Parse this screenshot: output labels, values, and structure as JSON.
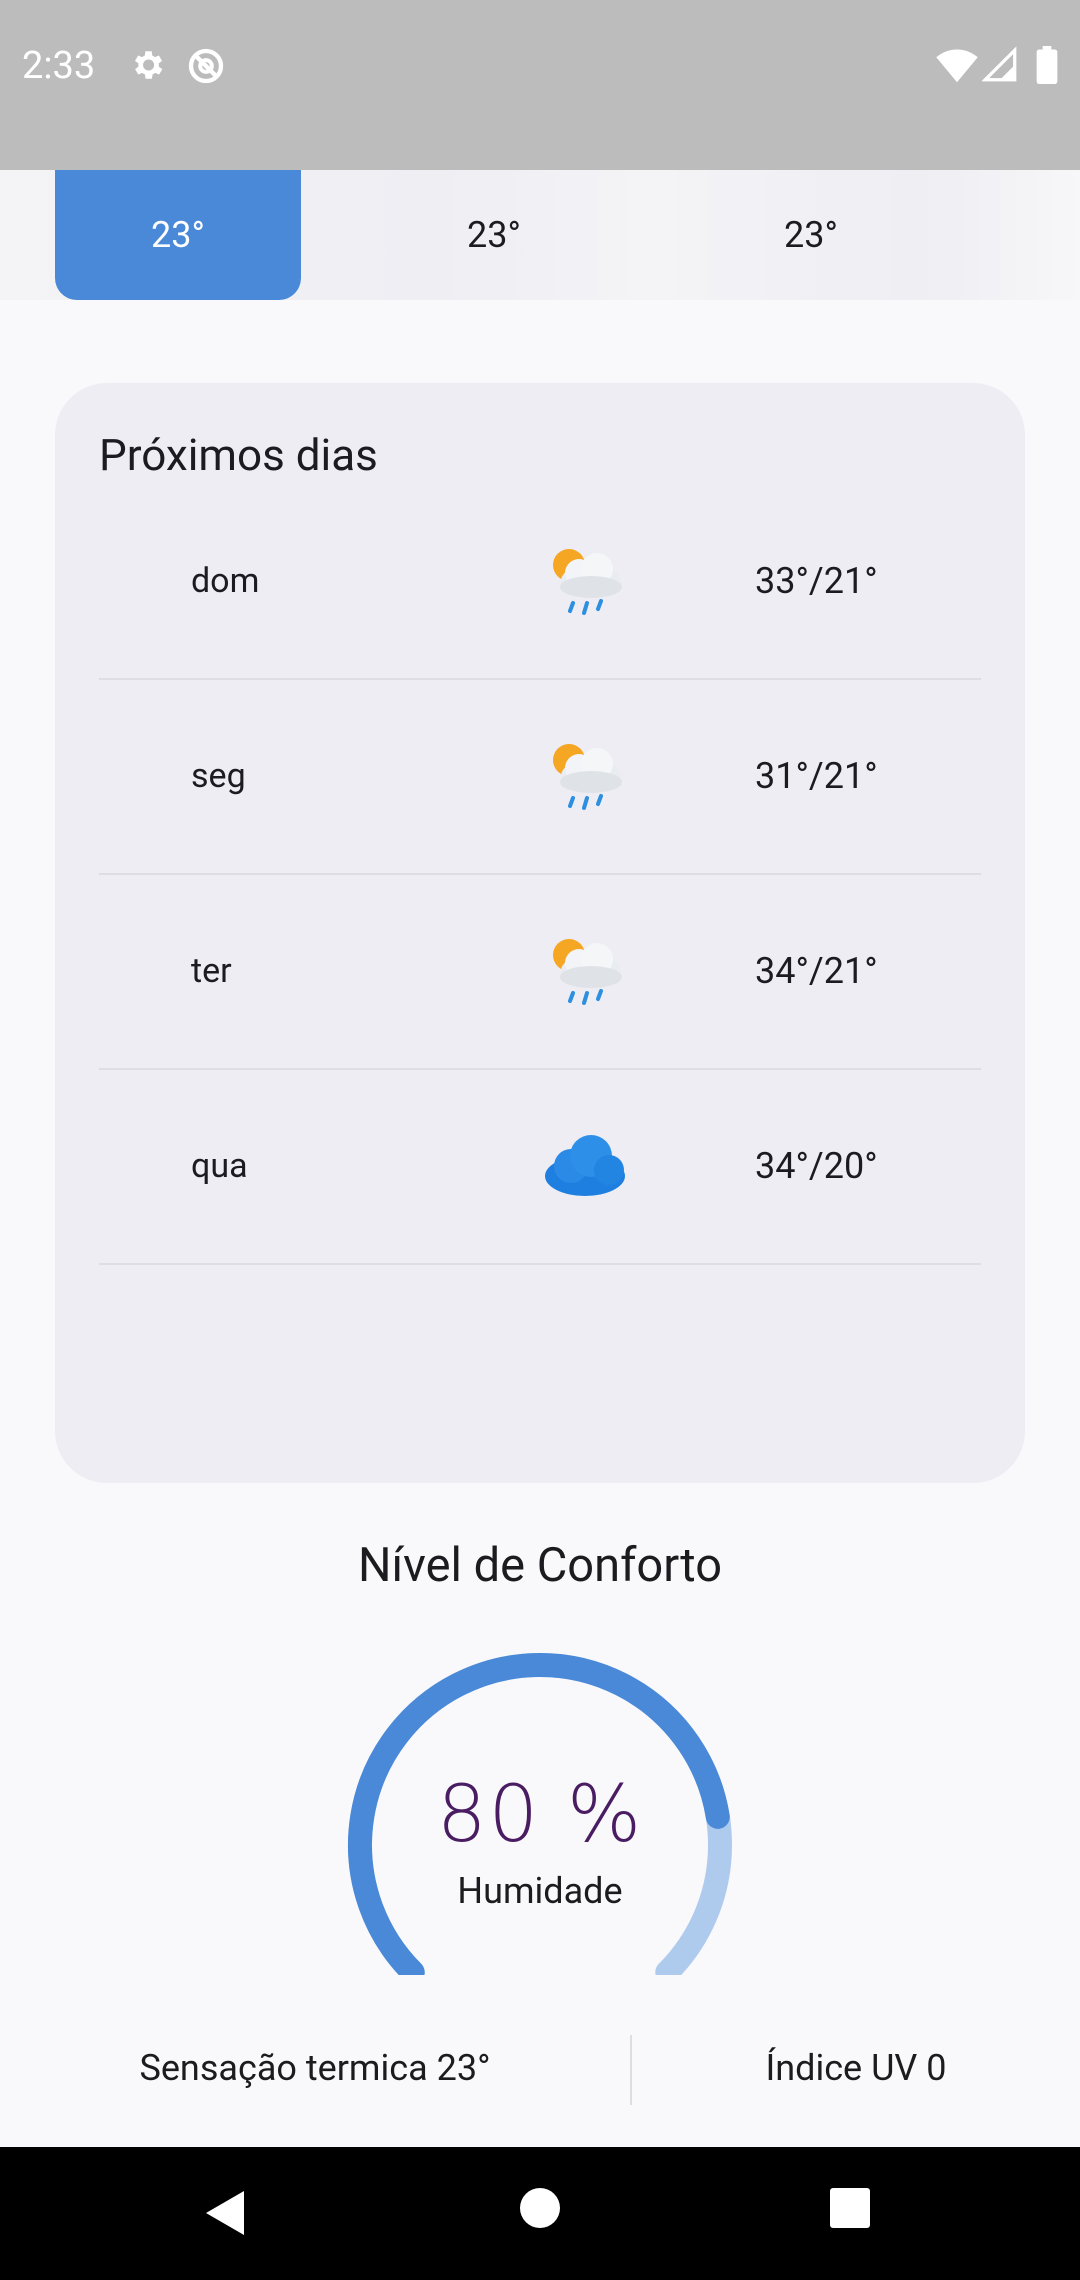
{
  "status_bar": {
    "time": "2:33",
    "icons": [
      "gear-icon",
      "no-data-sync-icon",
      "wifi-icon",
      "signal-icon",
      "battery-icon"
    ]
  },
  "hourly": {
    "items": [
      {
        "temp": "23°",
        "active": true
      },
      {
        "temp": "23°",
        "active": false
      },
      {
        "temp": "23°",
        "active": false
      }
    ]
  },
  "next_days": {
    "title": "Próximos dias",
    "items": [
      {
        "day": "dom",
        "icon": "sun-cloud-rain-icon",
        "temp": "33°/21°"
      },
      {
        "day": "seg",
        "icon": "sun-cloud-rain-icon",
        "temp": "31°/21°"
      },
      {
        "day": "ter",
        "icon": "sun-cloud-rain-icon",
        "temp": "34°/21°"
      },
      {
        "day": "qua",
        "icon": "cloud-icon",
        "temp": "34°/20°"
      }
    ]
  },
  "comfort": {
    "title": "Nível de Conforto",
    "value_text": "80 %",
    "humidity_fraction": 0.8,
    "label": "Humidade"
  },
  "stats": {
    "feels_like": "Sensação termica 23°",
    "uv_index": "Índice UV 0"
  },
  "colors": {
    "accent": "#4a88d8",
    "gauge_track": "#aecbee",
    "gauge_text": "#4a1d63"
  }
}
